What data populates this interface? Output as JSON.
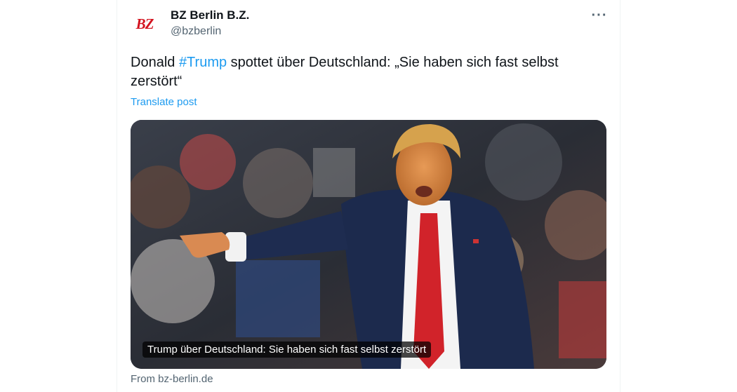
{
  "account": {
    "avatar_text": "BZ",
    "name": "BZ Berlin B.Z.",
    "handle": "@bzberlin"
  },
  "post": {
    "text_before": "Donald ",
    "hashtag": "#Trump",
    "text_after": " spottet über Deutschland: „Sie haben sich fast selbst zerstört“",
    "translate_label": "Translate post"
  },
  "card": {
    "image_caption": "Trump über Deutschland: Sie haben sich fast selbst zerstört",
    "source": "From bz-berlin.de"
  },
  "icons": {
    "more": "more-options-icon"
  },
  "colors": {
    "accent": "#1d9bf0",
    "brand": "#d3131f",
    "text": "#0f1419",
    "muted": "#536471"
  }
}
